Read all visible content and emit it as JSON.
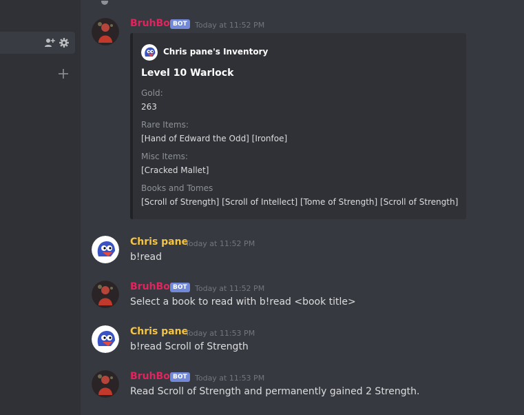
{
  "messages": [
    {
      "author": "BruhBot",
      "bot_tag": "BOT",
      "timestamp": "Today at 11:52 PM",
      "embed": {
        "author": "Chris pane's Inventory",
        "title": "Level 10 Warlock",
        "fields": [
          {
            "name": "Gold:",
            "value": "263"
          },
          {
            "name": "Rare Items:",
            "value": "[Hand of Edward the Odd] [Ironfoe]"
          },
          {
            "name": "Misc Items:",
            "value": "[Cracked Mallet]"
          },
          {
            "name": "Books and Tomes",
            "value": "[Scroll of Strength] [Scroll of Intellect] [Tome of Strength] [Scroll of Strength]"
          }
        ]
      }
    },
    {
      "author": "Chris pane",
      "timestamp": "Today at 11:52 PM",
      "content": "b!read"
    },
    {
      "author": "BruhBot",
      "bot_tag": "BOT",
      "timestamp": "Today at 11:52 PM",
      "content": "Select a book to read with b!read <book title>"
    },
    {
      "author": "Chris pane",
      "timestamp": "Today at 11:53 PM",
      "content": "b!read Scroll of Strength"
    },
    {
      "author": "BruhBot",
      "bot_tag": "BOT",
      "timestamp": "Today at 11:53 PM",
      "content": "Read Scroll of Strength and permanently gained 2 Strength."
    }
  ],
  "sidebar": {
    "channel_row_icons": [
      "add-member-icon",
      "gear-icon"
    ],
    "add_icon": "plus-icon"
  },
  "colors": {
    "background": "#36393f",
    "sidebar": "#2f3136",
    "bot_name": "#e0245e",
    "user_name": "#f5c543",
    "bot_tag": "#7289da"
  }
}
